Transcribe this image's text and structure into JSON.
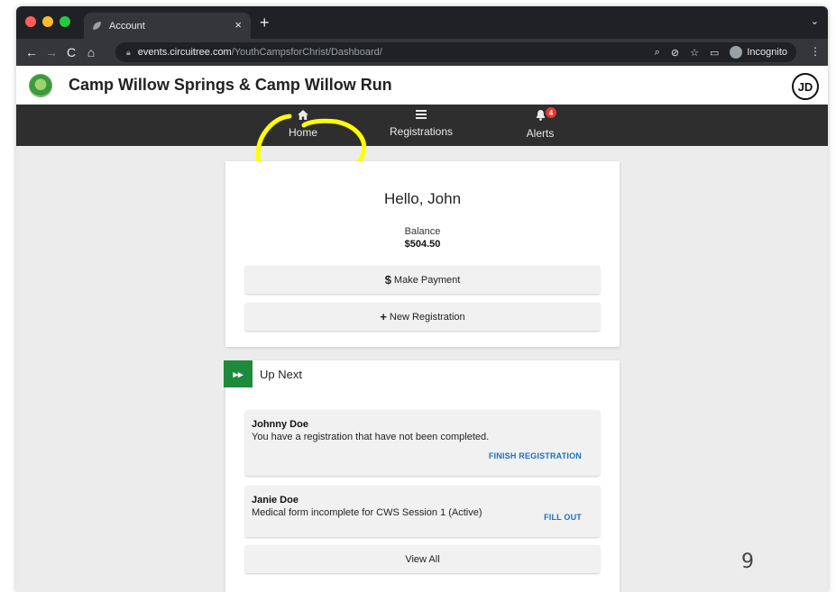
{
  "browser": {
    "tab_title": "Account",
    "tab_close": "×",
    "new_tab": "+",
    "tab_menu": "⌄",
    "url_host": "events.circuitree.com",
    "url_path": "/YouthCampsforChrist/Dashboard/",
    "incognito_label": "Incognito"
  },
  "site": {
    "title": "Camp Willow Springs & Camp Willow Run",
    "user_initials": "JD"
  },
  "nav": {
    "home": "Home",
    "registrations": "Registrations",
    "alerts": "Alerts",
    "alerts_count": "4"
  },
  "account": {
    "greeting": "Hello, John",
    "balance_label": "Balance",
    "balance_value": "$504.50",
    "make_payment": "Make Payment",
    "new_registration": "New Registration"
  },
  "up_next": {
    "title": "Up Next",
    "items": [
      {
        "name": "Johnny Doe",
        "message": "You have a registration that have not been completed.",
        "action": "FINISH REGISTRATION"
      },
      {
        "name": "Janie Doe",
        "message": "Medical form incomplete for CWS Session 1 (Active)",
        "action": "FILL OUT"
      }
    ],
    "view_all": "View All"
  },
  "slide_number": "9",
  "colors": {
    "highlight": "#ffff00",
    "accent_green": "#1e8a3c",
    "link_blue": "#1a6fc4",
    "navbar": "#2e2e2e"
  }
}
